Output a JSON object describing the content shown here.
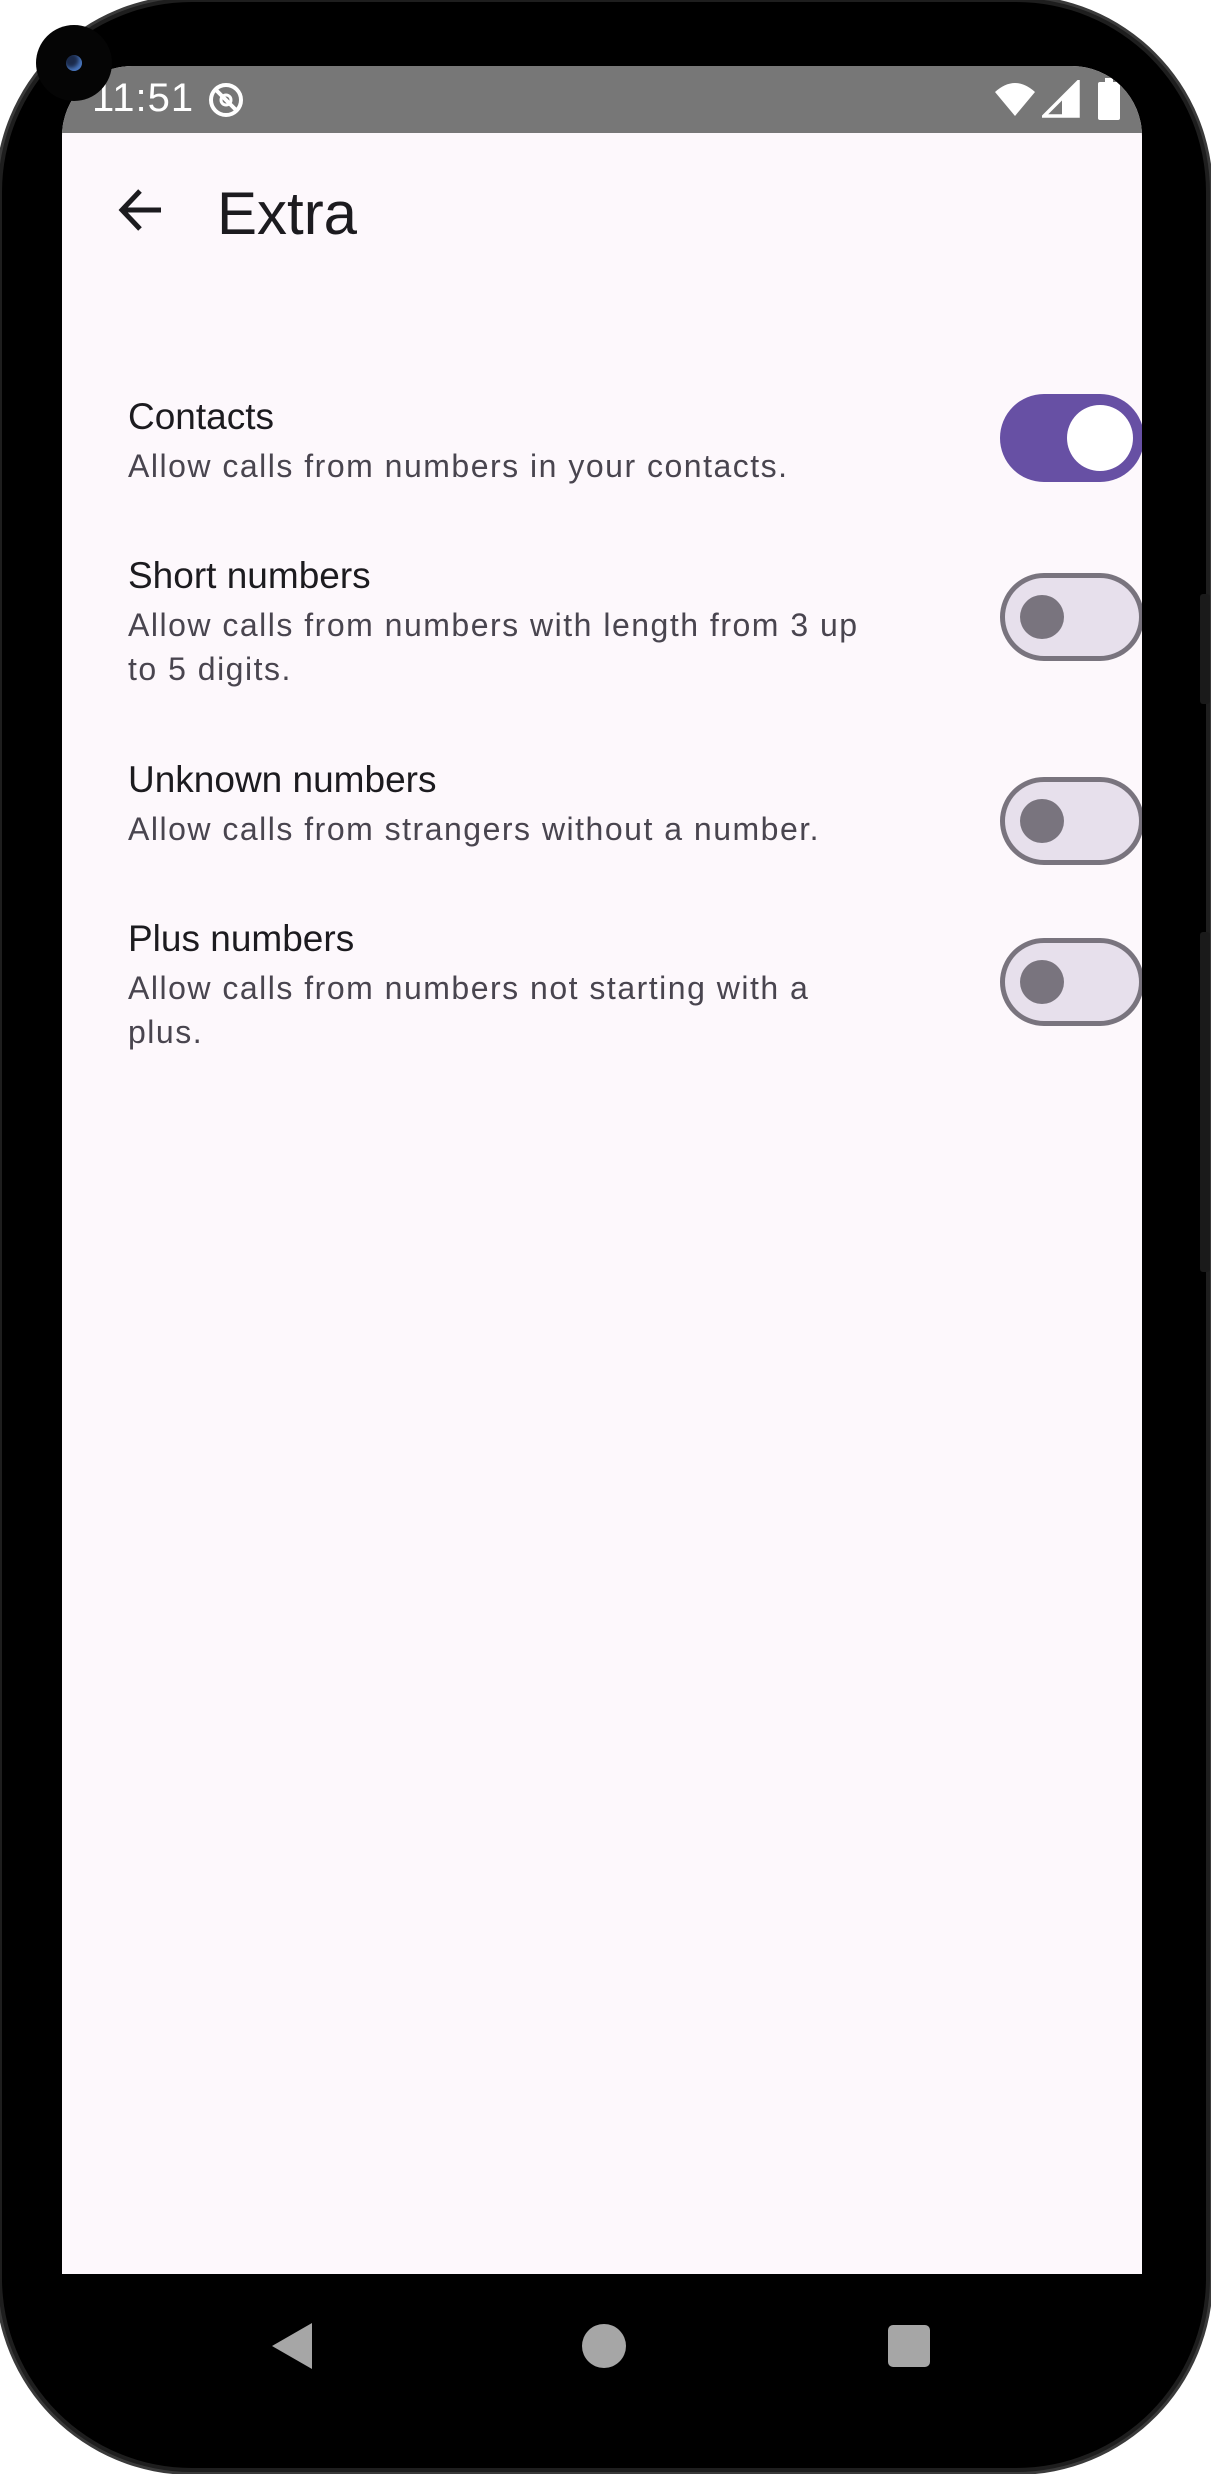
{
  "status_bar": {
    "time": "11:51",
    "icons": [
      "do-not-disturb-icon",
      "wifi-icon",
      "cellular-signal-icon",
      "battery-icon"
    ]
  },
  "app_bar": {
    "back_icon": "arrow-back-icon",
    "title": "Extra"
  },
  "settings": [
    {
      "title": "Contacts",
      "description": "Allow calls from numbers in your contacts.",
      "enabled": true
    },
    {
      "title": "Short numbers",
      "description": "Allow calls from numbers with length from 3 up to 5 digits.",
      "enabled": false
    },
    {
      "title": "Unknown numbers",
      "description": "Allow calls from strangers without a number.",
      "enabled": false
    },
    {
      "title": "Plus numbers",
      "description": "Allow calls from numbers not starting with a plus.",
      "enabled": false
    }
  ],
  "colors": {
    "accent": "#6750a4",
    "background": "#fdf8fc",
    "switch_off_track": "#e7e0ec",
    "switch_off_outline": "#79747e"
  },
  "nav_bar": {
    "icons": [
      "nav-back-icon",
      "nav-home-icon",
      "nav-recents-icon"
    ]
  }
}
